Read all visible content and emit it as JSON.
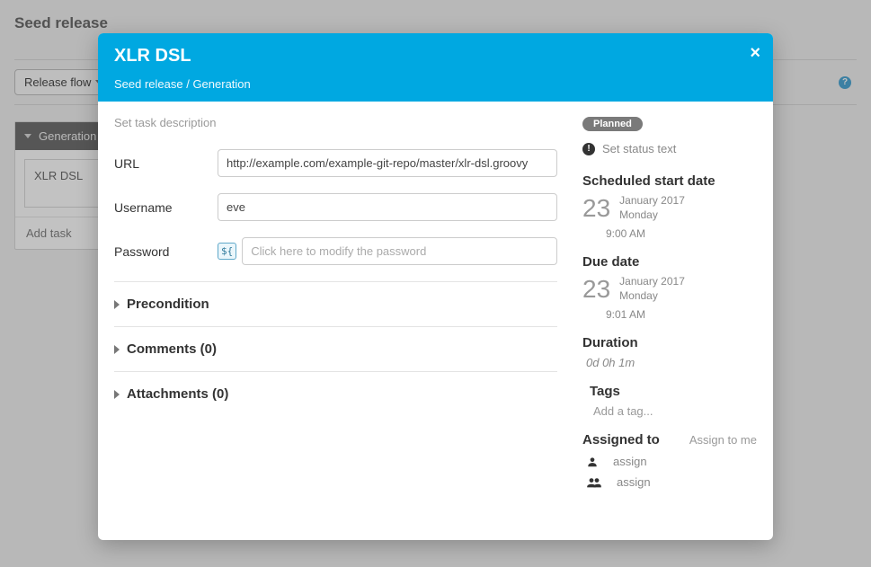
{
  "page": {
    "title": "Seed release",
    "release_flow_button": "Release flow",
    "help_glyph": "?"
  },
  "phase": {
    "name": "Generation",
    "task_name": "XLR DSL",
    "add_task": "Add task"
  },
  "modal": {
    "title": "XLR DSL",
    "breadcrumb": "Seed release / Generation",
    "close_glyph": "×",
    "description_placeholder": "Set task description",
    "fields": {
      "url": {
        "label": "URL",
        "value": "http://example.com/example-git-repo/master/xlr-dsl.groovy"
      },
      "username": {
        "label": "Username",
        "value": "eve"
      },
      "password": {
        "label": "Password",
        "placeholder": "Click here to modify the password",
        "var_chip": "${"
      }
    },
    "sections": {
      "precondition": "Precondition",
      "comments": "Comments (0)",
      "attachments": "Attachments (0)"
    }
  },
  "side": {
    "status_badge": "Planned",
    "status_text": "Set status text",
    "scheduled_heading": "Scheduled start date",
    "scheduled": {
      "day": "23",
      "month_year": "January 2017",
      "weekday": "Monday",
      "time": "9:00 AM"
    },
    "due_heading": "Due date",
    "due": {
      "day": "23",
      "month_year": "January 2017",
      "weekday": "Monday",
      "time": "9:01 AM"
    },
    "duration_heading": "Duration",
    "duration_value": "0d 0h 1m",
    "tags_heading": "Tags",
    "tags_placeholder": "Add a tag...",
    "assigned_heading": "Assigned to",
    "assign_to_me": "Assign to me",
    "assign_link": "assign"
  }
}
